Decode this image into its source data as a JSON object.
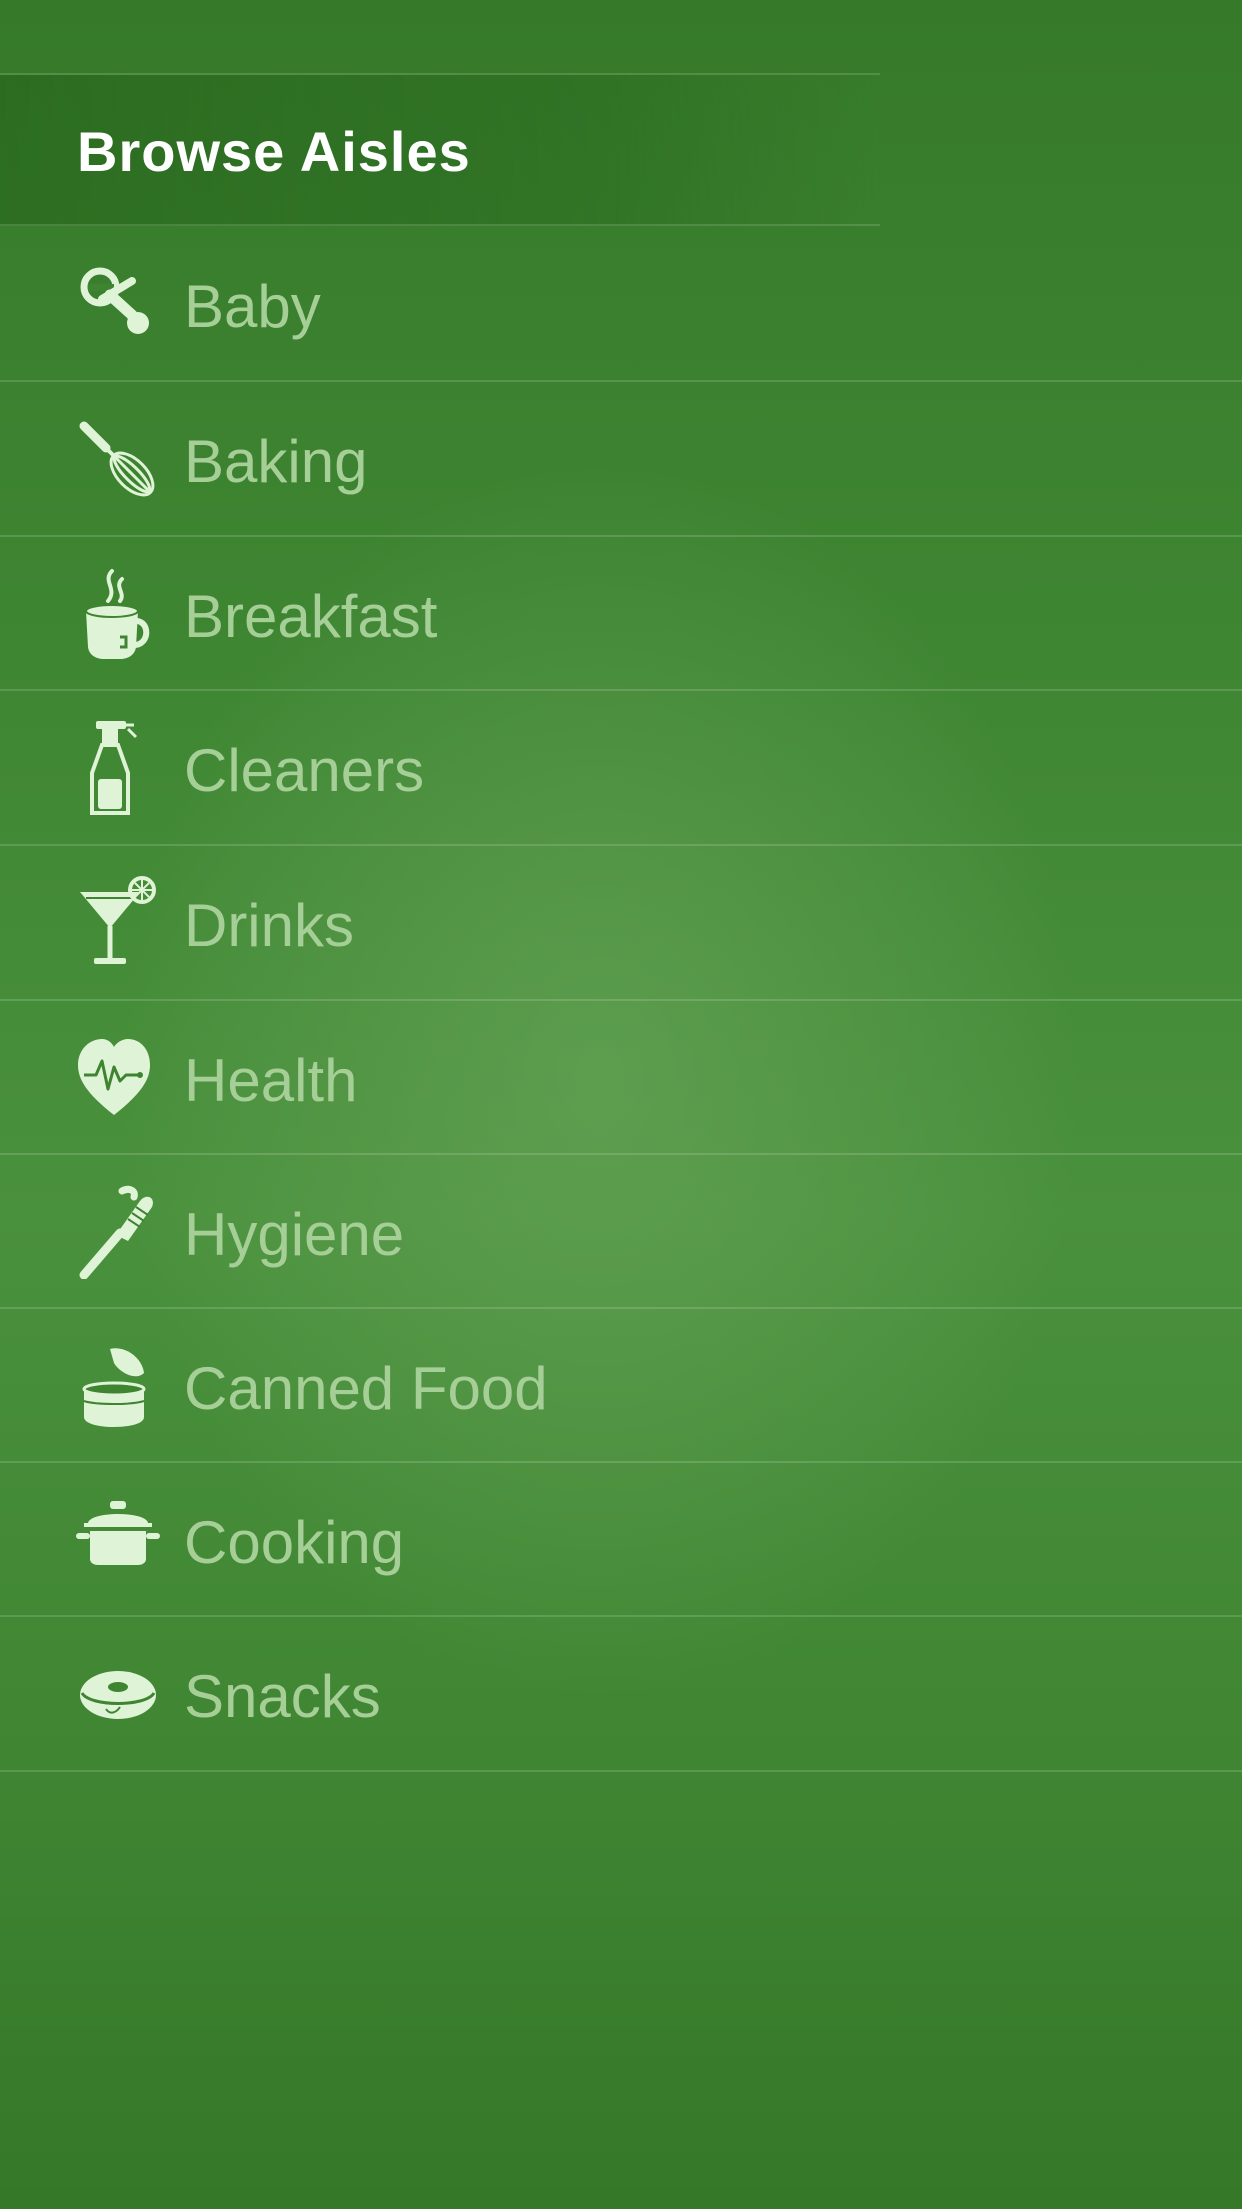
{
  "header": {
    "title": "Browse Aisles"
  },
  "aisles": [
    {
      "label": "Baby",
      "icon": "pacifier-icon"
    },
    {
      "label": "Baking",
      "icon": "whisk-icon"
    },
    {
      "label": "Breakfast",
      "icon": "coffee-cup-icon"
    },
    {
      "label": "Cleaners",
      "icon": "spray-bottle-icon"
    },
    {
      "label": "Drinks",
      "icon": "cocktail-glass-icon"
    },
    {
      "label": "Health",
      "icon": "heart-pulse-icon"
    },
    {
      "label": "Hygiene",
      "icon": "toothbrush-icon"
    },
    {
      "label": "Canned Food",
      "icon": "open-can-icon"
    },
    {
      "label": "Cooking",
      "icon": "cooking-pot-icon"
    },
    {
      "label": "Snacks",
      "icon": "donut-icon"
    }
  ],
  "colors": {
    "background": "#3f8633",
    "label": "#a6cf98",
    "icon": "#dff3d7",
    "header_text": "#ffffff"
  }
}
